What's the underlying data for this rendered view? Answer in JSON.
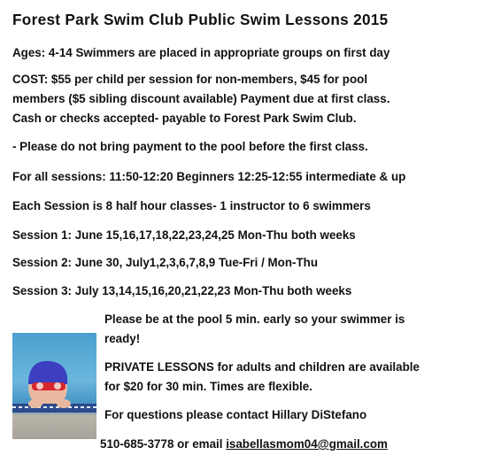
{
  "title": "Forest Park Swim Club Public Swim Lessons 2015",
  "lines": {
    "ages": "Ages: 4-14 Swimmers are placed in appropriate groups on first day",
    "cost1": "COST: $55 per child per session for non-members, $45 for pool",
    "cost2": "members ($5 sibling discount available) Payment due at first class.",
    "cost3": "Cash or checks accepted- payable to Forest Park Swim Club.",
    "payment_note": "- Please do not bring payment to the pool before the first class.",
    "times": "For all sessions: 11:50-12:20 Beginners 12:25-12:55 intermediate & up",
    "format": "Each Session is 8 half hour classes- 1 instructor to 6 swimmers",
    "session1": "Session 1: June 15,16,17,18,22,23,24,25 Mon-Thu both weeks",
    "session2": "Session 2: June 30, July1,2,3,6,7,8,9  Tue-Fri / Mon-Thu",
    "session3": "Session 3: July 13,14,15,16,20,21,22,23 Mon-Thu both weeks",
    "early1": "Please be at the pool 5 min. early so your swimmer is",
    "early2": "ready!",
    "private1": "PRIVATE LESSONS for adults and children are available",
    "private2": "for $20 for 30 min. Times are flexible.",
    "contact": "For questions please contact Hillary DiStefano",
    "phone": "510-685-3778  or email ",
    "email": "isabellasmom04@gmail.com"
  }
}
